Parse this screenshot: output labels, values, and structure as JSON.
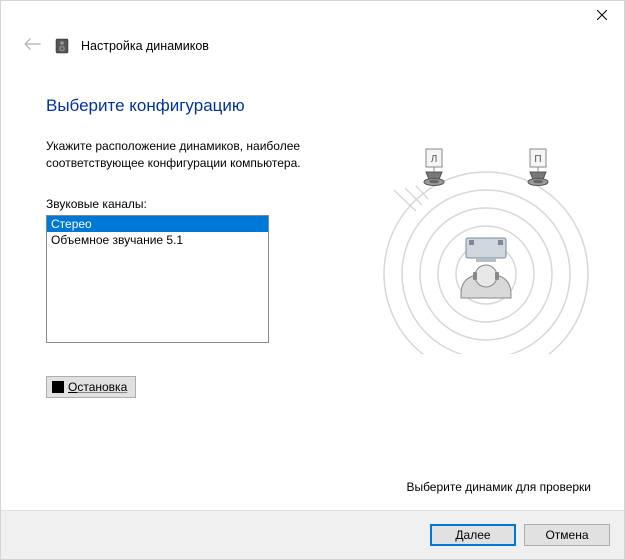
{
  "header": {
    "title": "Настройка динамиков"
  },
  "page": {
    "title": "Выберите конфигурацию",
    "instruction": "Укажите расположение динамиков, наиболее соответствующее конфигурации компьютера.",
    "list_label": "Звуковые каналы:",
    "options": [
      {
        "label": "Стерео",
        "selected": true
      },
      {
        "label": "Объемное звучание 5.1",
        "selected": false
      }
    ],
    "stop_button": "Остановка",
    "hint": "Выберите динамик для проверки"
  },
  "speakers": {
    "left_label": "Л",
    "right_label": "П"
  },
  "footer": {
    "next": "Далее",
    "cancel": "Отмена"
  }
}
